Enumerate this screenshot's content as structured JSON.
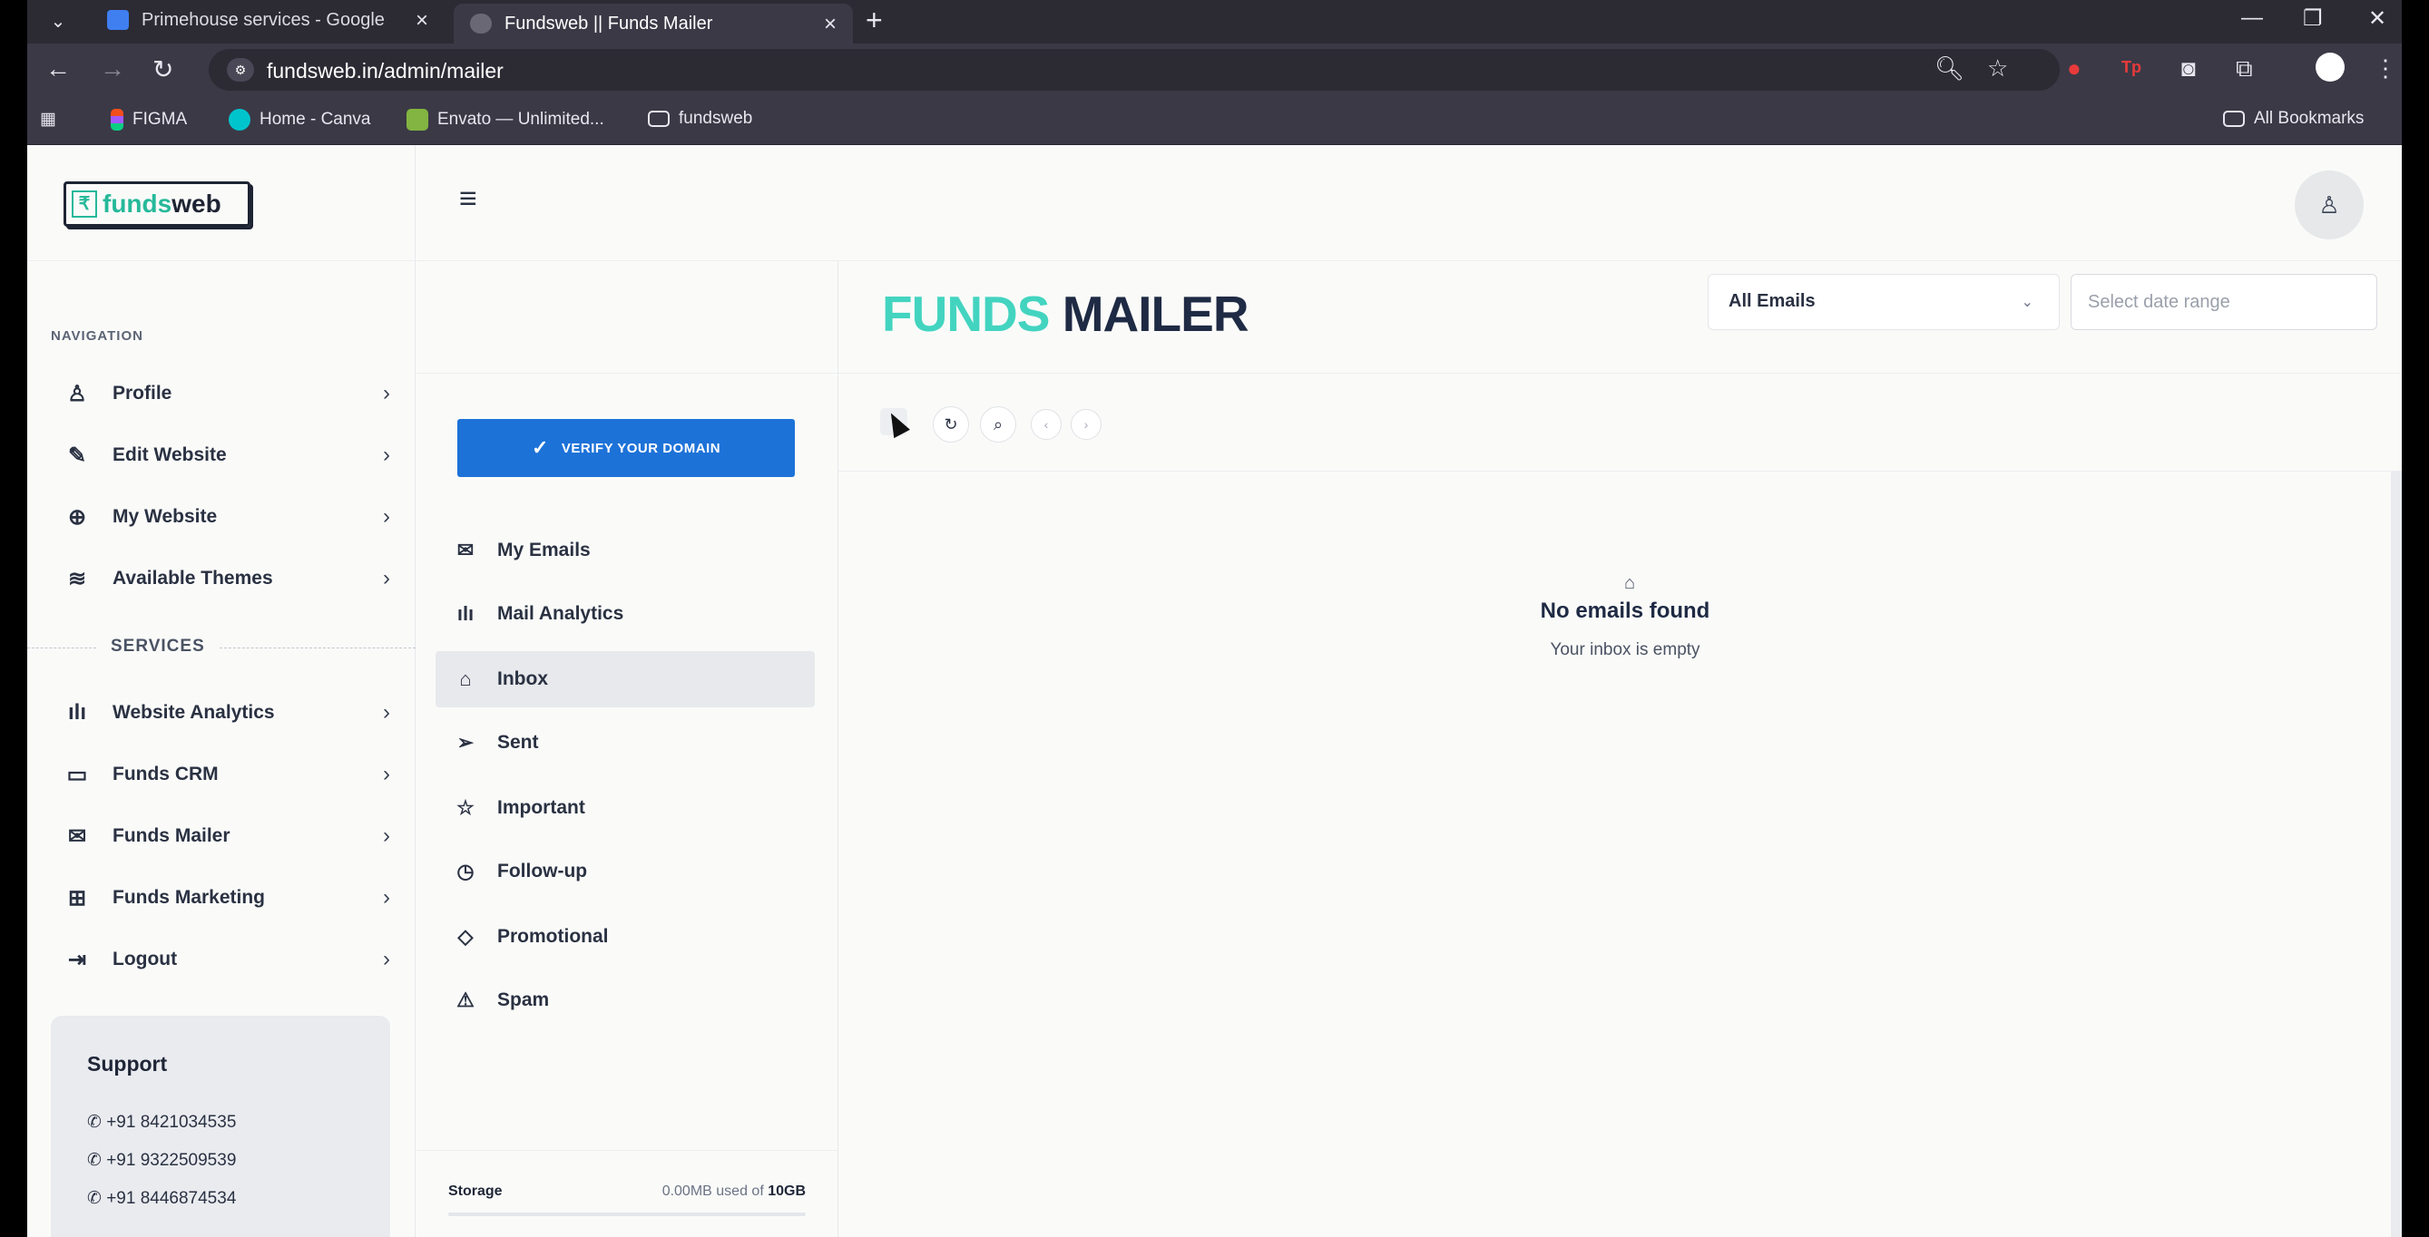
{
  "browser": {
    "tabs": [
      {
        "title": "Primehouse services - Google"
      },
      {
        "title": "Fundsweb || Funds Mailer"
      }
    ],
    "url": "fundsweb.in/admin/mailer",
    "bookmarks": [
      {
        "label": "FIGMA"
      },
      {
        "label": "Home - Canva"
      },
      {
        "label": "Envato — Unlimited..."
      },
      {
        "label": "fundsweb"
      }
    ],
    "all_bookmarks": "All Bookmarks"
  },
  "brand": {
    "logo_text_1": "funds",
    "logo_text_2": "web"
  },
  "sidebar": {
    "nav_heading": "NAVIGATION",
    "nav_items": [
      {
        "label": "Profile",
        "icon": "user-icon"
      },
      {
        "label": "Edit Website",
        "icon": "pencil-icon"
      },
      {
        "label": "My Website",
        "icon": "globe-icon"
      },
      {
        "label": "Available Themes",
        "icon": "layers-icon"
      }
    ],
    "services_heading": "SERVICES",
    "service_items": [
      {
        "label": "Website Analytics",
        "icon": "bar-chart-icon"
      },
      {
        "label": "Funds CRM",
        "icon": "monitor-icon"
      },
      {
        "label": "Funds Mailer",
        "icon": "mail-icon"
      },
      {
        "label": "Funds Marketing",
        "icon": "briefcase-icon"
      },
      {
        "label": "Logout",
        "icon": "logout-icon"
      }
    ],
    "support": {
      "title": "Support",
      "phones": [
        "+91 8421034535",
        "+91 9322509539",
        "+91 8446874534"
      ]
    }
  },
  "mail_nav": {
    "verify_button": "VERIFY YOUR DOMAIN",
    "items": [
      {
        "label": "My Emails",
        "icon": "mail-icon"
      },
      {
        "label": "Mail Analytics",
        "icon": "bar-chart-icon"
      },
      {
        "label": "Inbox",
        "icon": "inbox-icon"
      },
      {
        "label": "Sent",
        "icon": "send-icon"
      },
      {
        "label": "Important",
        "icon": "star-icon"
      },
      {
        "label": "Follow-up",
        "icon": "clock-icon"
      },
      {
        "label": "Promotional",
        "icon": "tag-icon"
      },
      {
        "label": "Spam",
        "icon": "warning-icon"
      }
    ],
    "active_item": "Inbox",
    "storage": {
      "label": "Storage",
      "used": "0.00MB used of ",
      "total": "10GB"
    }
  },
  "main": {
    "title_part1": "FUNDS",
    "title_part2": "MAILER",
    "filter_selected": "All Emails",
    "date_placeholder": "Select date range",
    "empty_title": "No emails found",
    "empty_subtitle": "Your inbox is empty"
  },
  "colors": {
    "accent_teal": "#43d4c0",
    "primary_blue": "#1d72d8",
    "dark_text": "#1f2a44"
  }
}
